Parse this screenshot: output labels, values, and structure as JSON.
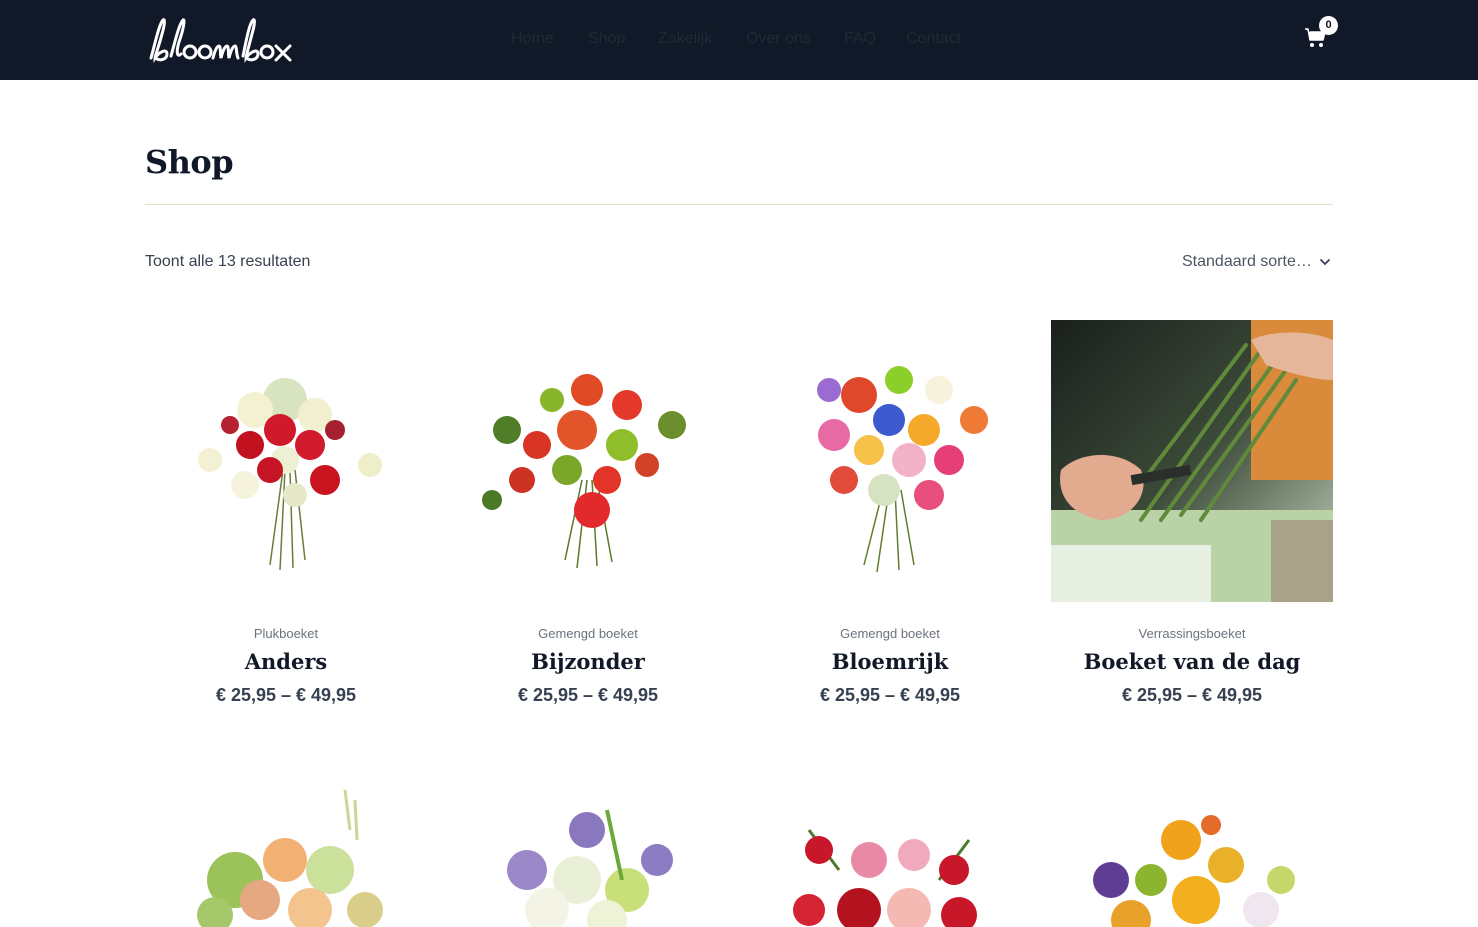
{
  "header": {
    "logo_text": "bloombox",
    "nav": [
      "Home",
      "Shop",
      "Zakelijk",
      "Over ons",
      "FAQ",
      "Contact"
    ],
    "cart_count": "0",
    "cart_icon": "shopping-cart-icon"
  },
  "page": {
    "title": "Shop",
    "result_count": "Toont alle 13 resultaten",
    "sort_value": "Standaard sortering"
  },
  "products": [
    {
      "category": "Plukboeket",
      "name": "Anders",
      "price": "€ 25,95 – € 49,95"
    },
    {
      "category": "Gemengd boeket",
      "name": "Bijzonder",
      "price": "€ 25,95 – € 49,95"
    },
    {
      "category": "Gemengd boeket",
      "name": "Bloemrijk",
      "price": "€ 25,95 – € 49,95"
    },
    {
      "category": "Verrassingsboeket",
      "name": "Boeket van de dag",
      "price": "€ 25,95 – € 49,95"
    }
  ],
  "colors": {
    "header_bg": "#111827",
    "title": "#111827",
    "divider": "#e8dccb"
  }
}
